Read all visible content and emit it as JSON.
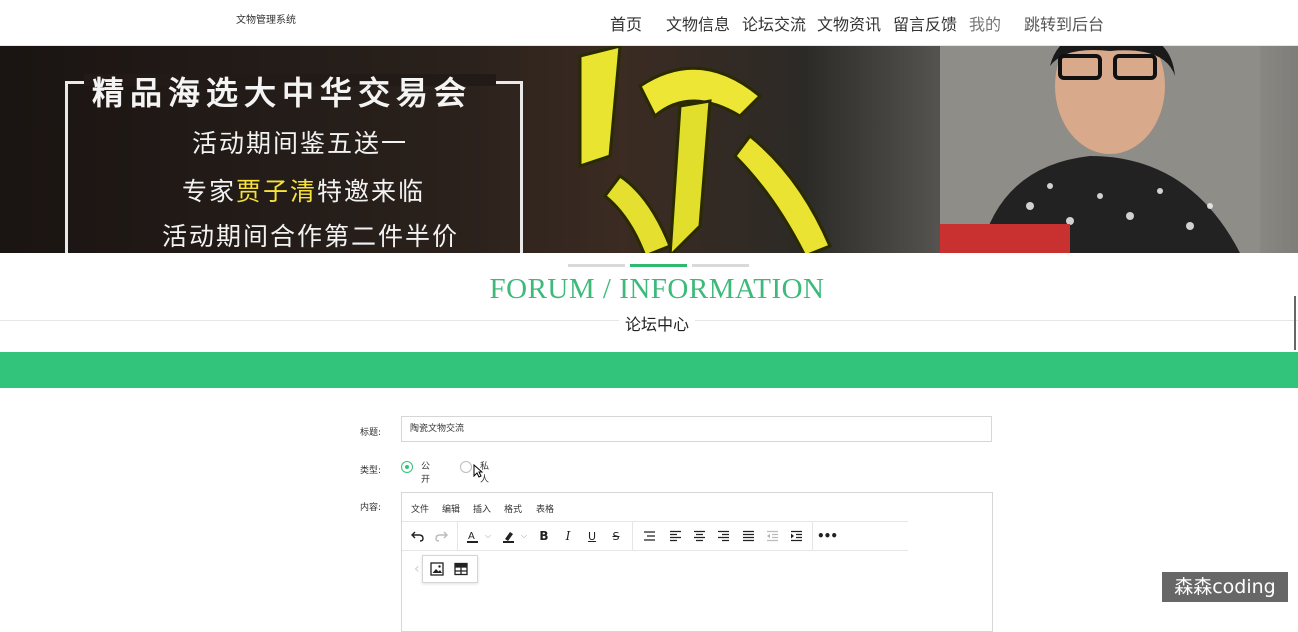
{
  "header": {
    "brand": "文物管理系统",
    "nav": [
      "首页",
      "文物信息",
      "论坛交流",
      "文物资讯",
      "留言反馈",
      "我的",
      "跳转到后台"
    ]
  },
  "banner": {
    "title": "精品海选大中华交易会",
    "line1": "活动期间鉴五送一",
    "line2_prefix": "专家",
    "line2_highlight": "贾子清",
    "line2_suffix": "特邀来临",
    "line3": "活动期间合作第二件半价"
  },
  "slider": {
    "count": 3,
    "active": 1
  },
  "section": {
    "title_en": "FORUM / INFORMATION",
    "title_zh": "论坛中心"
  },
  "form": {
    "title_label": "标题:",
    "title_value": "陶瓷文物交流",
    "type_label": "类型:",
    "type_options": [
      "公开",
      "私人"
    ],
    "type_selected": "公开",
    "content_label": "内容:",
    "editor_menus": [
      "文件",
      "编辑",
      "插入",
      "格式",
      "表格"
    ],
    "toolbar_icons": [
      "undo-icon",
      "redo-icon",
      "font-color-icon",
      "highlight-icon",
      "bold-icon",
      "italic-icon",
      "underline-icon",
      "strikethrough-icon",
      "line-height-icon",
      "align-left-icon",
      "align-center-icon",
      "align-right-icon",
      "justify-icon",
      "outdent-icon",
      "indent-icon",
      "more-icon"
    ],
    "quickbar_icons": [
      "image-icon",
      "table-icon"
    ]
  },
  "watermark": "森森coding",
  "colors": {
    "accent": "#33c47c",
    "title_green": "#3dba7a",
    "banner_highlight": "#f6e23a"
  }
}
